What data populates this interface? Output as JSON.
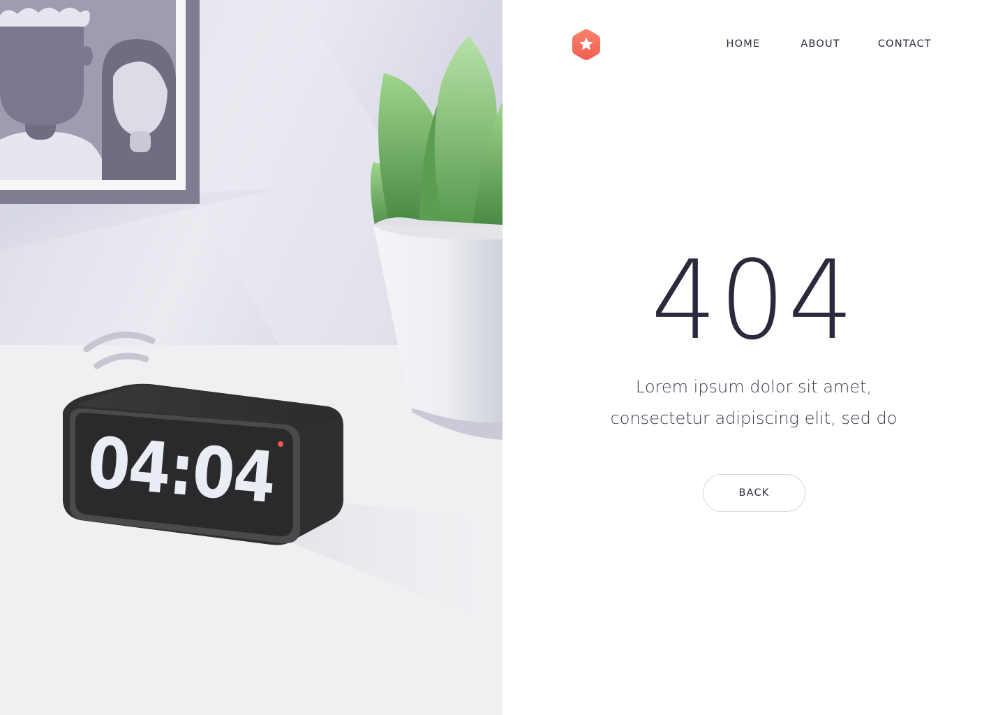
{
  "nav": {
    "items": [
      {
        "label": "HOME"
      },
      {
        "label": "ABOUT"
      },
      {
        "label": "CONTACT"
      }
    ]
  },
  "logo": {
    "icon": "star-hexagon-icon",
    "color": "#f4705a"
  },
  "error": {
    "code": "404",
    "message_line1": "Lorem ipsum dolor sit amet,",
    "message_line2": "consectetur adipiscing elit, sed do",
    "back_label": "BACK"
  },
  "illustration": {
    "clock_display": "04:04",
    "colors": {
      "wall": "#e4e5ee",
      "desk": "#eff0f2",
      "frame": "#7f7d92",
      "clock_body": "#2f2f31",
      "clock_digits": "#e8eef4",
      "plant_leaf": "#6fb062",
      "alarm_dot": "#f4584a"
    }
  }
}
